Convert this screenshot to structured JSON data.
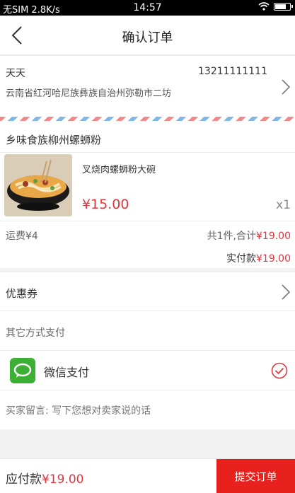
{
  "status_bar": {
    "carrier": "无SIM 2.8K/s",
    "time": "14:57"
  },
  "navbar": {
    "title": "确认订单"
  },
  "address": {
    "name": "天天",
    "phone": "13211111111",
    "address": "云南省红河哈尼族彝族自治州弥勒市二坊"
  },
  "shop": {
    "name": "乡味食族柳州螺蛳粉",
    "item": {
      "name": "叉烧肉螺蛳粉大碗",
      "price": "¥15.00",
      "qty": "x1"
    },
    "shipping": "运费¥4",
    "sum_prefix": "共1件,合计",
    "sum_value": "¥19.00",
    "paid_prefix": "实付款",
    "paid_value": "¥19.00"
  },
  "coupon": {
    "label": "优惠券"
  },
  "payment": {
    "other_label": "其它方式支付",
    "wechat_label": "微信支付"
  },
  "message": {
    "placeholder": "买家留言: 写下您想对卖家说的话"
  },
  "footer": {
    "total_prefix": "应付款",
    "total_value": "¥19.00",
    "submit_label": "提交订单"
  },
  "colors": {
    "accent": "#e0363d",
    "submit": "#e8211f",
    "wechat": "#3cb034"
  }
}
